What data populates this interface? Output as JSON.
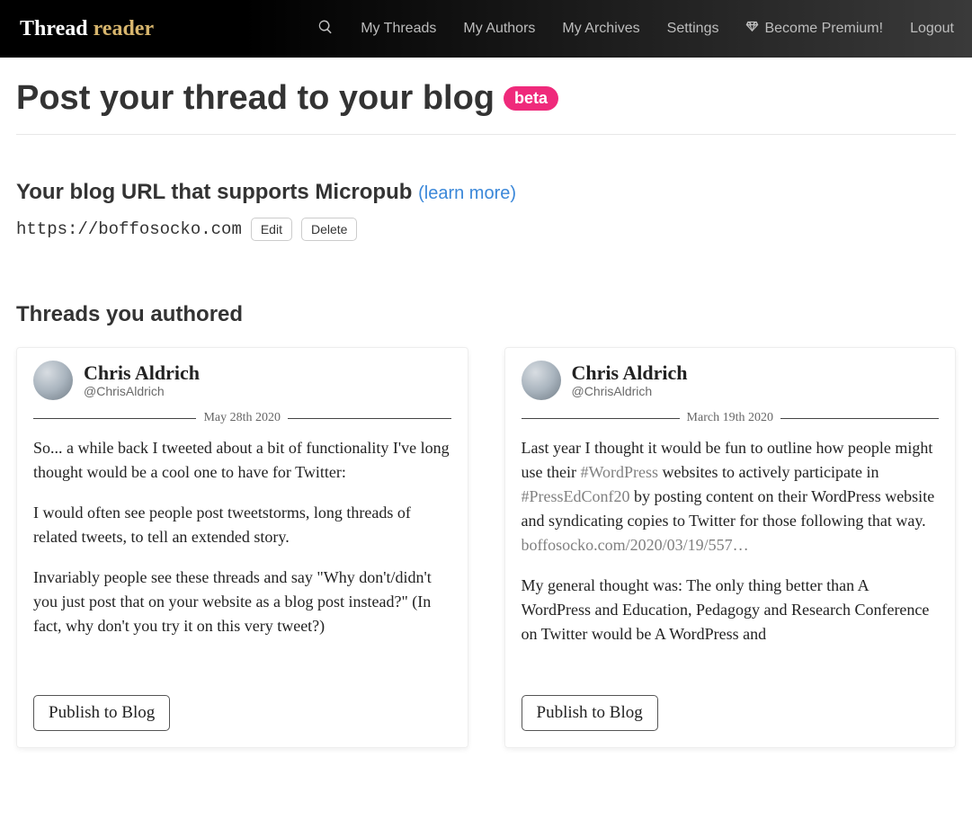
{
  "brand": {
    "part1": "Thread ",
    "part2": "reader"
  },
  "nav": {
    "my_threads": "My Threads",
    "my_authors": "My Authors",
    "my_archives": "My Archives",
    "settings": "Settings",
    "premium": "Become Premium!",
    "logout": "Logout"
  },
  "page": {
    "title": "Post your thread to your blog",
    "beta_badge": "beta"
  },
  "micropub": {
    "heading": "Your blog URL that supports Micropub ",
    "learn_more": "(learn more)",
    "url": "https://boffosocko.com",
    "edit": "Edit",
    "delete": "Delete"
  },
  "threads_section": {
    "heading": "Threads you authored"
  },
  "threads": [
    {
      "author_name": "Chris Aldrich",
      "author_handle": "@ChrisAldrich",
      "date": "May 28th 2020",
      "p1": "So... a while back I tweeted about a bit of functionality I've long thought would be a cool one to have for Twitter:",
      "p2": "I would often see people post tweetstorms, long threads of related tweets, to tell an extended story.",
      "p3": "Invariably people see these threads and say \"Why don't/didn't you just post that on your website as a blog post instead?\" (In fact, why don't you try it on this very tweet?)",
      "publish": "Publish to Blog"
    },
    {
      "author_name": "Chris Aldrich",
      "author_handle": "@ChrisAldrich",
      "date": "March 19th 2020",
      "p1a": "Last year I thought it would be fun to outline how people might use their ",
      "hashtag1": "#WordPress",
      "p1b": " websites to actively participate in ",
      "hashtag2": "#PressEdConf20",
      "p1c": " by posting content on their WordPress website and syndicating copies to Twitter for those following that way.",
      "link": "boffosocko.com/2020/03/19/557…",
      "p2": "My general thought was: The only thing better than A WordPress and Education, Pedagogy and Research Conference on Twitter would be A WordPress and",
      "publish": "Publish to Blog"
    }
  ]
}
